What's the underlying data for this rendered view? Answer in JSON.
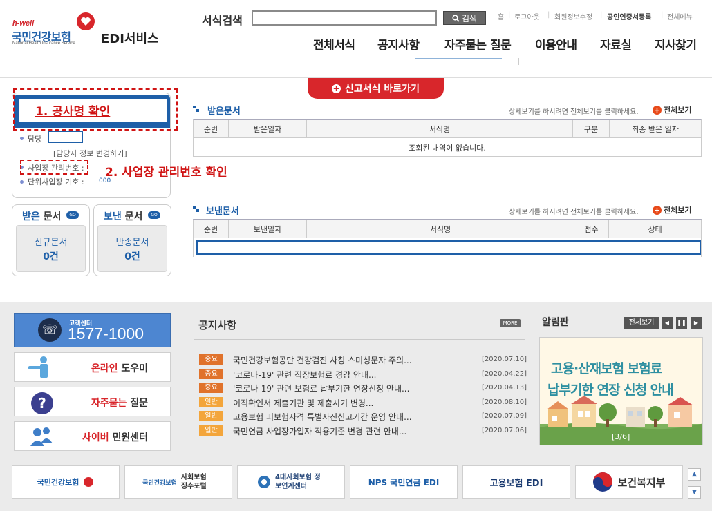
{
  "brand": {
    "hwell": "h-well",
    "name": "국민건강보험",
    "sub": "National Health Insurance Service",
    "service": "EDI서비스"
  },
  "search": {
    "label": "서식검색",
    "value": "",
    "button": "검색"
  },
  "util_links": [
    "홈",
    "로그아웃",
    "회원정보수정",
    "공인인증서등록",
    "전체메뉴"
  ],
  "gnb": [
    "전체서식",
    "공지사항",
    "자주묻는 질문",
    "이용안내",
    "자료실",
    "지사찾기"
  ],
  "shortcut": {
    "label": "신고서식 바로가기"
  },
  "left_panel": {
    "annotation1": "1. 공사명 확인",
    "annotation2": "2. 사업장 관리번호 확인",
    "damdang_label": "담당",
    "change_link": "[담당자 정보 변경하기]",
    "biz_label": "사업장 관리번호 :",
    "unit_label": "단위사업장 기호 :",
    "unit_value": "000",
    "received": {
      "title_a": "받은",
      "title_b": " 문서",
      "go": "GO",
      "inner": "신규문서",
      "count": "0건"
    },
    "sent": {
      "title_a": "보낸",
      "title_b": " 문서",
      "go": "GO",
      "inner": "반송문서",
      "count": "0건"
    }
  },
  "received_docs": {
    "title": "받은문서",
    "hint": "상세보기를 하시려면 전체보기를 클릭하세요.",
    "all": "전체보기",
    "columns": [
      "순번",
      "받은일자",
      "서식명",
      "구분",
      "최종 받은 일자"
    ],
    "empty": "조회된 내역이 없습니다."
  },
  "sent_docs": {
    "title": "보낸문서",
    "hint": "상세보기를 하시려면 전체보기를 클릭하세요.",
    "all": "전체보기",
    "columns": [
      "순번",
      "보낸일자",
      "서식명",
      "접수",
      "상태"
    ]
  },
  "support": {
    "center_label": "고객센터",
    "phone": "1577-1000",
    "online_a": "온라인",
    "online_b": " 도우미",
    "faq_a": "자주묻는",
    "faq_b": " 질문",
    "cyber_a": "사이버",
    "cyber_b": " 민원센터"
  },
  "notice": {
    "title": "공지사항",
    "more": "MORE",
    "items": [
      {
        "badge": "중요",
        "type": "imp",
        "text": "국민건강보험공단 건강검진 사칭 스미싱문자 주의...",
        "date": "[2020.07.10]"
      },
      {
        "badge": "중요",
        "type": "imp",
        "text": "'코로나-19' 관련 직장보험료 경감 안내...",
        "date": "[2020.04.22]"
      },
      {
        "badge": "중요",
        "type": "imp",
        "text": "'코로나-19' 관련 보험료 납부기한 연장신청 안내...",
        "date": "[2020.04.13]"
      },
      {
        "badge": "일반",
        "type": "gen",
        "text": "이직확인서 제출기관 및 제출시기 변경...",
        "date": "[2020.08.10]"
      },
      {
        "badge": "일반",
        "type": "gen",
        "text": "고용보험 피보험자격 특별자진신고기간 운영 안내...",
        "date": "[2020.07.09]"
      },
      {
        "badge": "일반",
        "type": "gen",
        "text": "국민연금 사업장가입자 적용기준 변경 관련 안내...",
        "date": "[2020.07.06]"
      }
    ]
  },
  "alarm": {
    "title": "알림판",
    "all": "전체보기",
    "banner_line1": "고용·산재보험 보험료",
    "banner_line2": "납부기한 연장 신청 안내",
    "page": "[3/6]"
  },
  "footer_logos": [
    {
      "name": "국민건강보험",
      "sub": ""
    },
    {
      "name": "국민건강보험",
      "sub": "사회보험 징수포털"
    },
    {
      "name": "4대사회보험 정보연계센터",
      "sub": ""
    },
    {
      "name": "NPS 국민연금 EDI",
      "sub": ""
    },
    {
      "name": "고용보험 EDI",
      "sub": ""
    },
    {
      "name": "보건복지부",
      "sub": ""
    }
  ],
  "colors": {
    "brand_blue": "#1e5fa8",
    "brand_red": "#d8262b",
    "annotation_red": "#d01414",
    "notice_important": "#e0722b",
    "notice_general": "#f3a53b"
  }
}
